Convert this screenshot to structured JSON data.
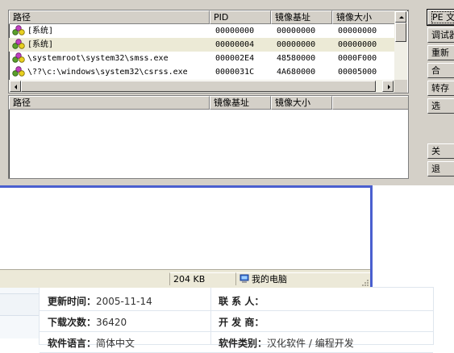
{
  "dialog": {
    "process_list": {
      "headers": [
        "路径",
        "PID",
        "镜像基址",
        "镜像大小"
      ],
      "rows": [
        {
          "path": "[系统]",
          "pid": "00000000",
          "base": "00000000",
          "size": "00000000"
        },
        {
          "path": "[系统]",
          "pid": "00000004",
          "base": "00000000",
          "size": "00000000"
        },
        {
          "path": "\\systemroot\\system32\\smss.exe",
          "pid": "000002E4",
          "base": "48580000",
          "size": "0000F000"
        },
        {
          "path": "\\??\\c:\\windows\\system32\\csrss.exe",
          "pid": "0000031C",
          "base": "4A680000",
          "size": "00005000"
        }
      ]
    },
    "module_list": {
      "headers": [
        "路径",
        "镜像基址",
        "镜像大小"
      ]
    },
    "buttons": [
      {
        "label": "PE 文"
      },
      {
        "label": "调试器"
      },
      {
        "label": "重新"
      },
      {
        "label": "合"
      },
      {
        "label": "转存"
      },
      {
        "label": "选"
      },
      {
        "label": "关"
      },
      {
        "label": "退"
      }
    ]
  },
  "explorer": {
    "status": {
      "size": "204 KB",
      "location": "我的电脑"
    }
  },
  "web": {
    "info": {
      "update_label": "更新时间：",
      "update_value": "2005-11-14",
      "contact_label": "联 系 人：",
      "contact_value": "",
      "downloads_label": "下载次数：",
      "downloads_value": "36420",
      "developer_label": "开 发 商：",
      "developer_value": "",
      "language_label": "软件语言：",
      "language_value": "简体中文",
      "category_label": "软件类别：",
      "category_value": "汉化软件 / 编程开发"
    }
  },
  "colors": {
    "dialog_face": "#d4d0c8",
    "explorer_border": "#4a5fcf",
    "alt_row": "#ecead6"
  }
}
